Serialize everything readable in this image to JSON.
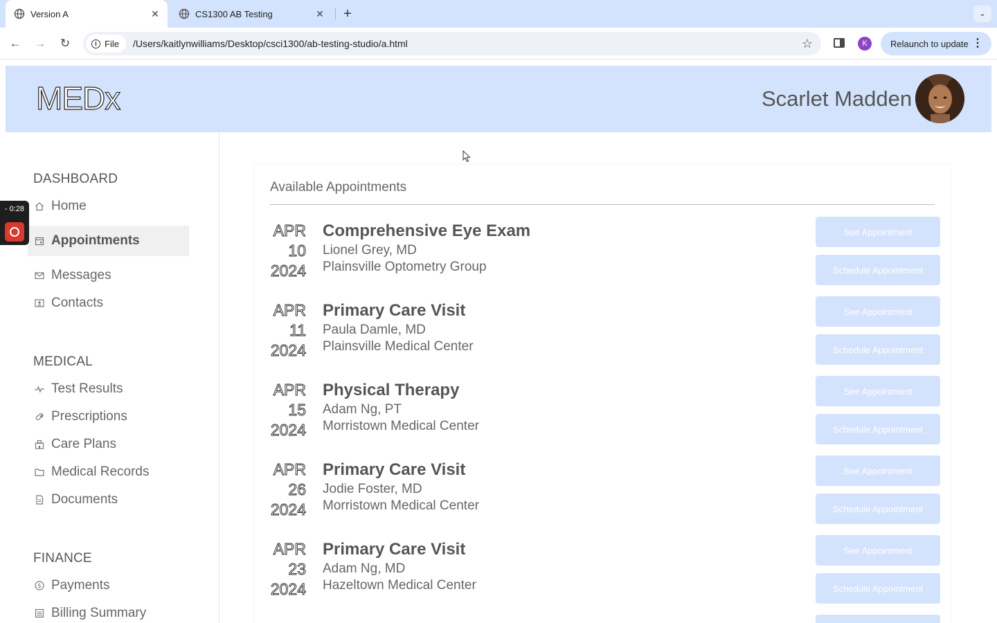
{
  "browser": {
    "tabs": [
      {
        "title": "Version A",
        "active": true
      },
      {
        "title": "CS1300 AB Testing",
        "active": false
      }
    ],
    "chip_label": "File",
    "url": "/Users/kaitlynwilliams/Desktop/csci1300/ab-testing-studio/a.html",
    "profile_initial": "K",
    "relaunch_label": "Relaunch to update"
  },
  "recorder": {
    "time": "- 0:28"
  },
  "header": {
    "logo": "MEDx",
    "user_name": "Scarlet Madden"
  },
  "sidebar": {
    "sections": [
      {
        "title": "DASHBOARD",
        "items": [
          {
            "label": "Home",
            "icon": "home-icon"
          },
          {
            "label": "Appointments",
            "icon": "calendar-icon",
            "active": true
          },
          {
            "label": "Messages",
            "icon": "envelope-icon"
          },
          {
            "label": "Contacts",
            "icon": "contact-card-icon"
          }
        ]
      },
      {
        "title": "MEDICAL",
        "items": [
          {
            "label": "Test Results",
            "icon": "pulse-icon"
          },
          {
            "label": "Prescriptions",
            "icon": "pill-icon"
          },
          {
            "label": "Care Plans",
            "icon": "hospital-icon"
          },
          {
            "label": "Medical Records",
            "icon": "folder-icon"
          },
          {
            "label": "Documents",
            "icon": "document-icon"
          }
        ]
      },
      {
        "title": "FINANCE",
        "items": [
          {
            "label": "Payments",
            "icon": "dollar-circle-icon"
          },
          {
            "label": "Billing Summary",
            "icon": "list-icon"
          }
        ]
      }
    ]
  },
  "main": {
    "card_title": "Available Appointments",
    "see_label": "See Appointment",
    "schedule_label": "Schedule Appointment",
    "appointments": [
      {
        "month": "APR",
        "day": "10",
        "year": "2024",
        "title": "Comprehensive Eye Exam",
        "doctor": "Lionel Grey, MD",
        "location": "Plainsville Optometry Group"
      },
      {
        "month": "APR",
        "day": "11",
        "year": "2024",
        "title": "Primary Care Visit",
        "doctor": "Paula Damle, MD",
        "location": "Plainsville Medical Center"
      },
      {
        "month": "APR",
        "day": "15",
        "year": "2024",
        "title": "Physical Therapy",
        "doctor": "Adam Ng, PT",
        "location": "Morristown Medical Center"
      },
      {
        "month": "APR",
        "day": "26",
        "year": "2024",
        "title": "Primary Care Visit",
        "doctor": "Jodie Foster, MD",
        "location": "Morristown Medical Center"
      },
      {
        "month": "APR",
        "day": "23",
        "year": "2024",
        "title": "Primary Care Visit",
        "doctor": "Adam Ng, MD",
        "location": "Hazeltown Medical Center"
      }
    ]
  },
  "colors": {
    "header_bg": "#d3e3fd",
    "button_bg": "#d3e3fd",
    "active_nav_bg": "#f0f0f0",
    "record_red": "#d93a2e"
  }
}
